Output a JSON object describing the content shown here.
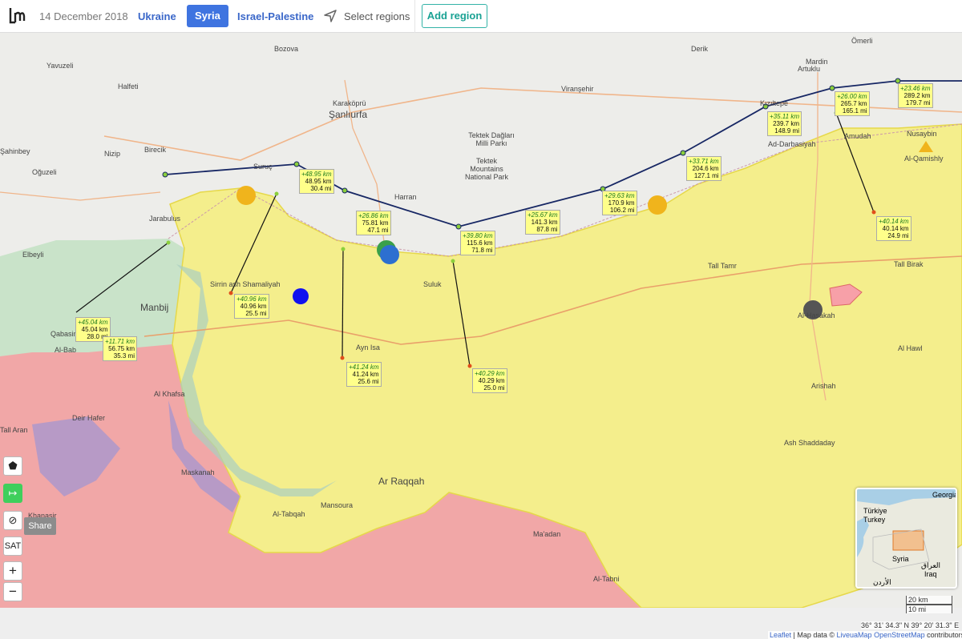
{
  "topbar": {
    "date": "14 December 2018",
    "regions": [
      "Ukraine",
      "Syria",
      "Israel-Palestine"
    ],
    "select_regions": "Select regions",
    "add_region": "Add region"
  },
  "controls": {
    "share": "Share",
    "sat": "SAT",
    "zoom_in": "+",
    "zoom_out": "−",
    "arrow": "↦",
    "polygon": "⬟",
    "hide": "⊘"
  },
  "colors": {
    "yellow_zone": "#f3ee8b",
    "red_zone": "#f0a6a6",
    "green_zone": "#c9e3c9",
    "purple_zone": "#b99ac6",
    "route": "#172764",
    "label_bg": "#ffff8a"
  },
  "place_labels": [
    "Bozova",
    "Derik",
    "Ömerli",
    "Yavuzeli",
    "Halfeti",
    "Karaköprü",
    "Şanlıurfa",
    "Viranşehir",
    "Artuklu",
    "Mardin",
    "Kızıltepe",
    "Nusaybin",
    "Nizip",
    "Birecik",
    "Oğuzeli",
    "Şahinbey",
    "Suruç",
    "Harran",
    "Tektek Dağları Milli Parkı",
    "Tektek Mountains National Park",
    "Elbeyli",
    "Jarabulus",
    "Manbij",
    "Sirrin ash Shamaliyah",
    "Suluk",
    "Tall Tamr",
    "Tall Birak",
    "Ad-Darbasiyah",
    "Amudah",
    "Al-Qamishly",
    "Al-Hasakah",
    "Al Hawl",
    "Ayn Isa",
    "Qabasin",
    "Al Khafsa",
    "Deir Hafer",
    "Maskanah",
    "Khanasir",
    "Ar Raqqah",
    "Mansoura",
    "Al-Tabqah",
    "Ash Shaddaday",
    "Arishah",
    "Ma'adan",
    "Al-Tabni",
    "Al-Bab",
    "Tall Aran"
  ],
  "distance_labels": [
    {
      "inc": "+48.95 km",
      "km": "48.95 km",
      "mi": "30.4 mi"
    },
    {
      "inc": "+26.86 km",
      "km": "75.81 km",
      "mi": "47.1 mi"
    },
    {
      "inc": "+39.80 km",
      "km": "115.6 km",
      "mi": "71.8 mi"
    },
    {
      "inc": "+25.67 km",
      "km": "141.3 km",
      "mi": "87.8 mi"
    },
    {
      "inc": "+29.63 km",
      "km": "170.9 km",
      "mi": "106.2 mi"
    },
    {
      "inc": "+33.71 km",
      "km": "204.6 km",
      "mi": "127.1 mi"
    },
    {
      "inc": "+35.11 km",
      "km": "239.7 km",
      "mi": "148.9 mi"
    },
    {
      "inc": "+26.00 km",
      "km": "265.7 km",
      "mi": "165.1 mi"
    },
    {
      "inc": "+23.46 km",
      "km": "289.2 km",
      "mi": "179.7 mi"
    },
    {
      "inc": "+45.04 km",
      "km": "45.04 km",
      "mi": "28.0 mi"
    },
    {
      "inc": "+11.71 km",
      "km": "56.75 km",
      "mi": "35.3 mi"
    },
    {
      "inc": "+40.96 km",
      "km": "40.96 km",
      "mi": "25.5 mi"
    },
    {
      "inc": "+41.24 km",
      "km": "41.24 km",
      "mi": "25.6 mi"
    },
    {
      "inc": "+40.29 km",
      "km": "40.29 km",
      "mi": "25.0 mi"
    },
    {
      "inc": "+40.14 km",
      "km": "40.14 km",
      "mi": "24.9 mi"
    }
  ],
  "inset": {
    "labels": [
      "Georgia",
      "Türkiye",
      "Turkey",
      "Syria",
      "العراق",
      "Iraq",
      "الأردن"
    ]
  },
  "scale": {
    "km": "20 km",
    "mi": "10 mi"
  },
  "coords": "36° 31' 34.3\" N 39° 20' 31.3\" E",
  "attribution": {
    "leaflet": "Leaflet",
    "text": " | Map data © ",
    "liveua": "LiveuaMap",
    "osm": "OpenStreetMap",
    "contrib": " contributors"
  }
}
